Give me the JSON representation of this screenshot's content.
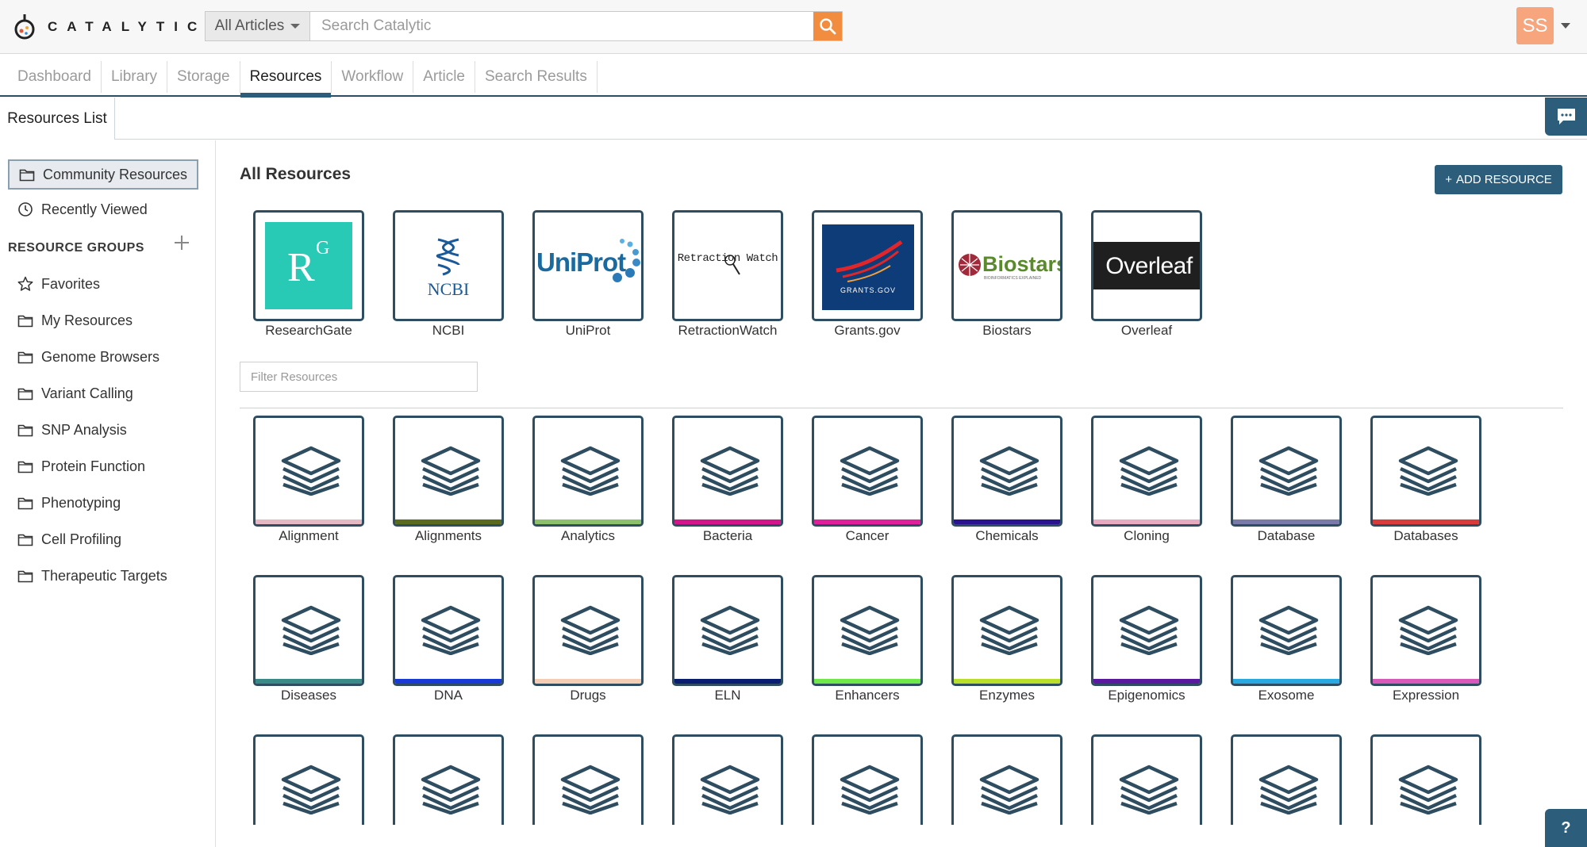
{
  "header": {
    "logo_text": "CATALYTIC",
    "search_scope": "All Articles",
    "search_placeholder": "Search Catalytic",
    "user_initials": "SS",
    "colors": {
      "search_button": "#f28c3e",
      "avatar": "#f6a57d",
      "primary": "#2c5d7a"
    }
  },
  "nav": {
    "tabs": [
      {
        "label": "Dashboard",
        "active": false
      },
      {
        "label": "Library",
        "active": false
      },
      {
        "label": "Storage",
        "active": false
      },
      {
        "label": "Resources",
        "active": true
      },
      {
        "label": "Workflow",
        "active": false
      },
      {
        "label": "Article",
        "active": false
      },
      {
        "label": "Search Results",
        "active": false
      }
    ]
  },
  "subbar": {
    "tab_label": "Resources List"
  },
  "sidebar": {
    "top_items": [
      {
        "label": "Community Resources",
        "icon": "folder-icon",
        "active": true
      },
      {
        "label": "Recently Viewed",
        "icon": "clock-icon",
        "active": false
      }
    ],
    "groups_heading": "RESOURCE GROUPS",
    "groups": [
      {
        "label": "Favorites",
        "icon": "star-icon"
      },
      {
        "label": "My Resources",
        "icon": "folder-icon"
      },
      {
        "label": "Genome Browsers",
        "icon": "folder-icon"
      },
      {
        "label": "Variant Calling",
        "icon": "folder-icon"
      },
      {
        "label": "SNP Analysis",
        "icon": "folder-icon"
      },
      {
        "label": "Protein Function",
        "icon": "folder-icon"
      },
      {
        "label": "Phenotyping",
        "icon": "folder-icon"
      },
      {
        "label": "Cell Profiling",
        "icon": "folder-icon"
      },
      {
        "label": "Therapeutic Targets",
        "icon": "folder-icon"
      }
    ]
  },
  "main": {
    "title": "All Resources",
    "add_button_label": "ADD RESOURCE",
    "filter_placeholder": "Filter Resources",
    "featured": [
      {
        "label": "ResearchGate",
        "logo_text": "R",
        "logo_sup": "G",
        "icon": "researchgate-logo"
      },
      {
        "label": "NCBI",
        "logo_text": "NCBI",
        "icon": "ncbi-logo"
      },
      {
        "label": "UniProt",
        "logo_text": "UniProt",
        "icon": "uniprot-logo"
      },
      {
        "label": "RetractionWatch",
        "logo_text": "Retraction Watch",
        "icon": "retractionwatch-logo"
      },
      {
        "label": "Grants.gov",
        "logo_text": "GRANTS.GOV",
        "icon": "grantsgov-logo"
      },
      {
        "label": "Biostars",
        "logo_text": "Biostars",
        "logo_subtext": "BIOINFORMATICS EXPLAINED",
        "icon": "biostars-logo"
      },
      {
        "label": "Overleaf",
        "logo_text": "Overleaf",
        "icon": "overleaf-logo"
      }
    ],
    "categories": [
      {
        "label": "Alignment",
        "color": "#e6b8c4"
      },
      {
        "label": "Alignments",
        "color": "#5a6b1e"
      },
      {
        "label": "Analytics",
        "color": "#8cc06b"
      },
      {
        "label": "Bacteria",
        "color": "#d4148a"
      },
      {
        "label": "Cancer",
        "color": "#e0209a"
      },
      {
        "label": "Chemicals",
        "color": "#2a1490"
      },
      {
        "label": "Cloning",
        "color": "#e8aac0"
      },
      {
        "label": "Database",
        "color": "#7a7aa8"
      },
      {
        "label": "Databases",
        "color": "#d93a3a"
      },
      {
        "label": "Diseases",
        "color": "#3a8a88"
      },
      {
        "label": "DNA",
        "color": "#1a3ad8"
      },
      {
        "label": "Drugs",
        "color": "#f3cdb4"
      },
      {
        "label": "ELN",
        "color": "#0a1e70"
      },
      {
        "label": "Enhancers",
        "color": "#6fe84a"
      },
      {
        "label": "Enzymes",
        "color": "#b8e02a"
      },
      {
        "label": "Epigenomics",
        "color": "#5a1aa0"
      },
      {
        "label": "Exosome",
        "color": "#2aa8e0"
      },
      {
        "label": "Expression",
        "color": "#d85ab8"
      },
      {
        "label": "",
        "color": ""
      },
      {
        "label": "",
        "color": ""
      },
      {
        "label": "",
        "color": ""
      },
      {
        "label": "",
        "color": ""
      },
      {
        "label": "",
        "color": ""
      },
      {
        "label": "",
        "color": ""
      },
      {
        "label": "",
        "color": ""
      },
      {
        "label": "",
        "color": ""
      },
      {
        "label": "",
        "color": ""
      }
    ]
  },
  "help_label": "?"
}
